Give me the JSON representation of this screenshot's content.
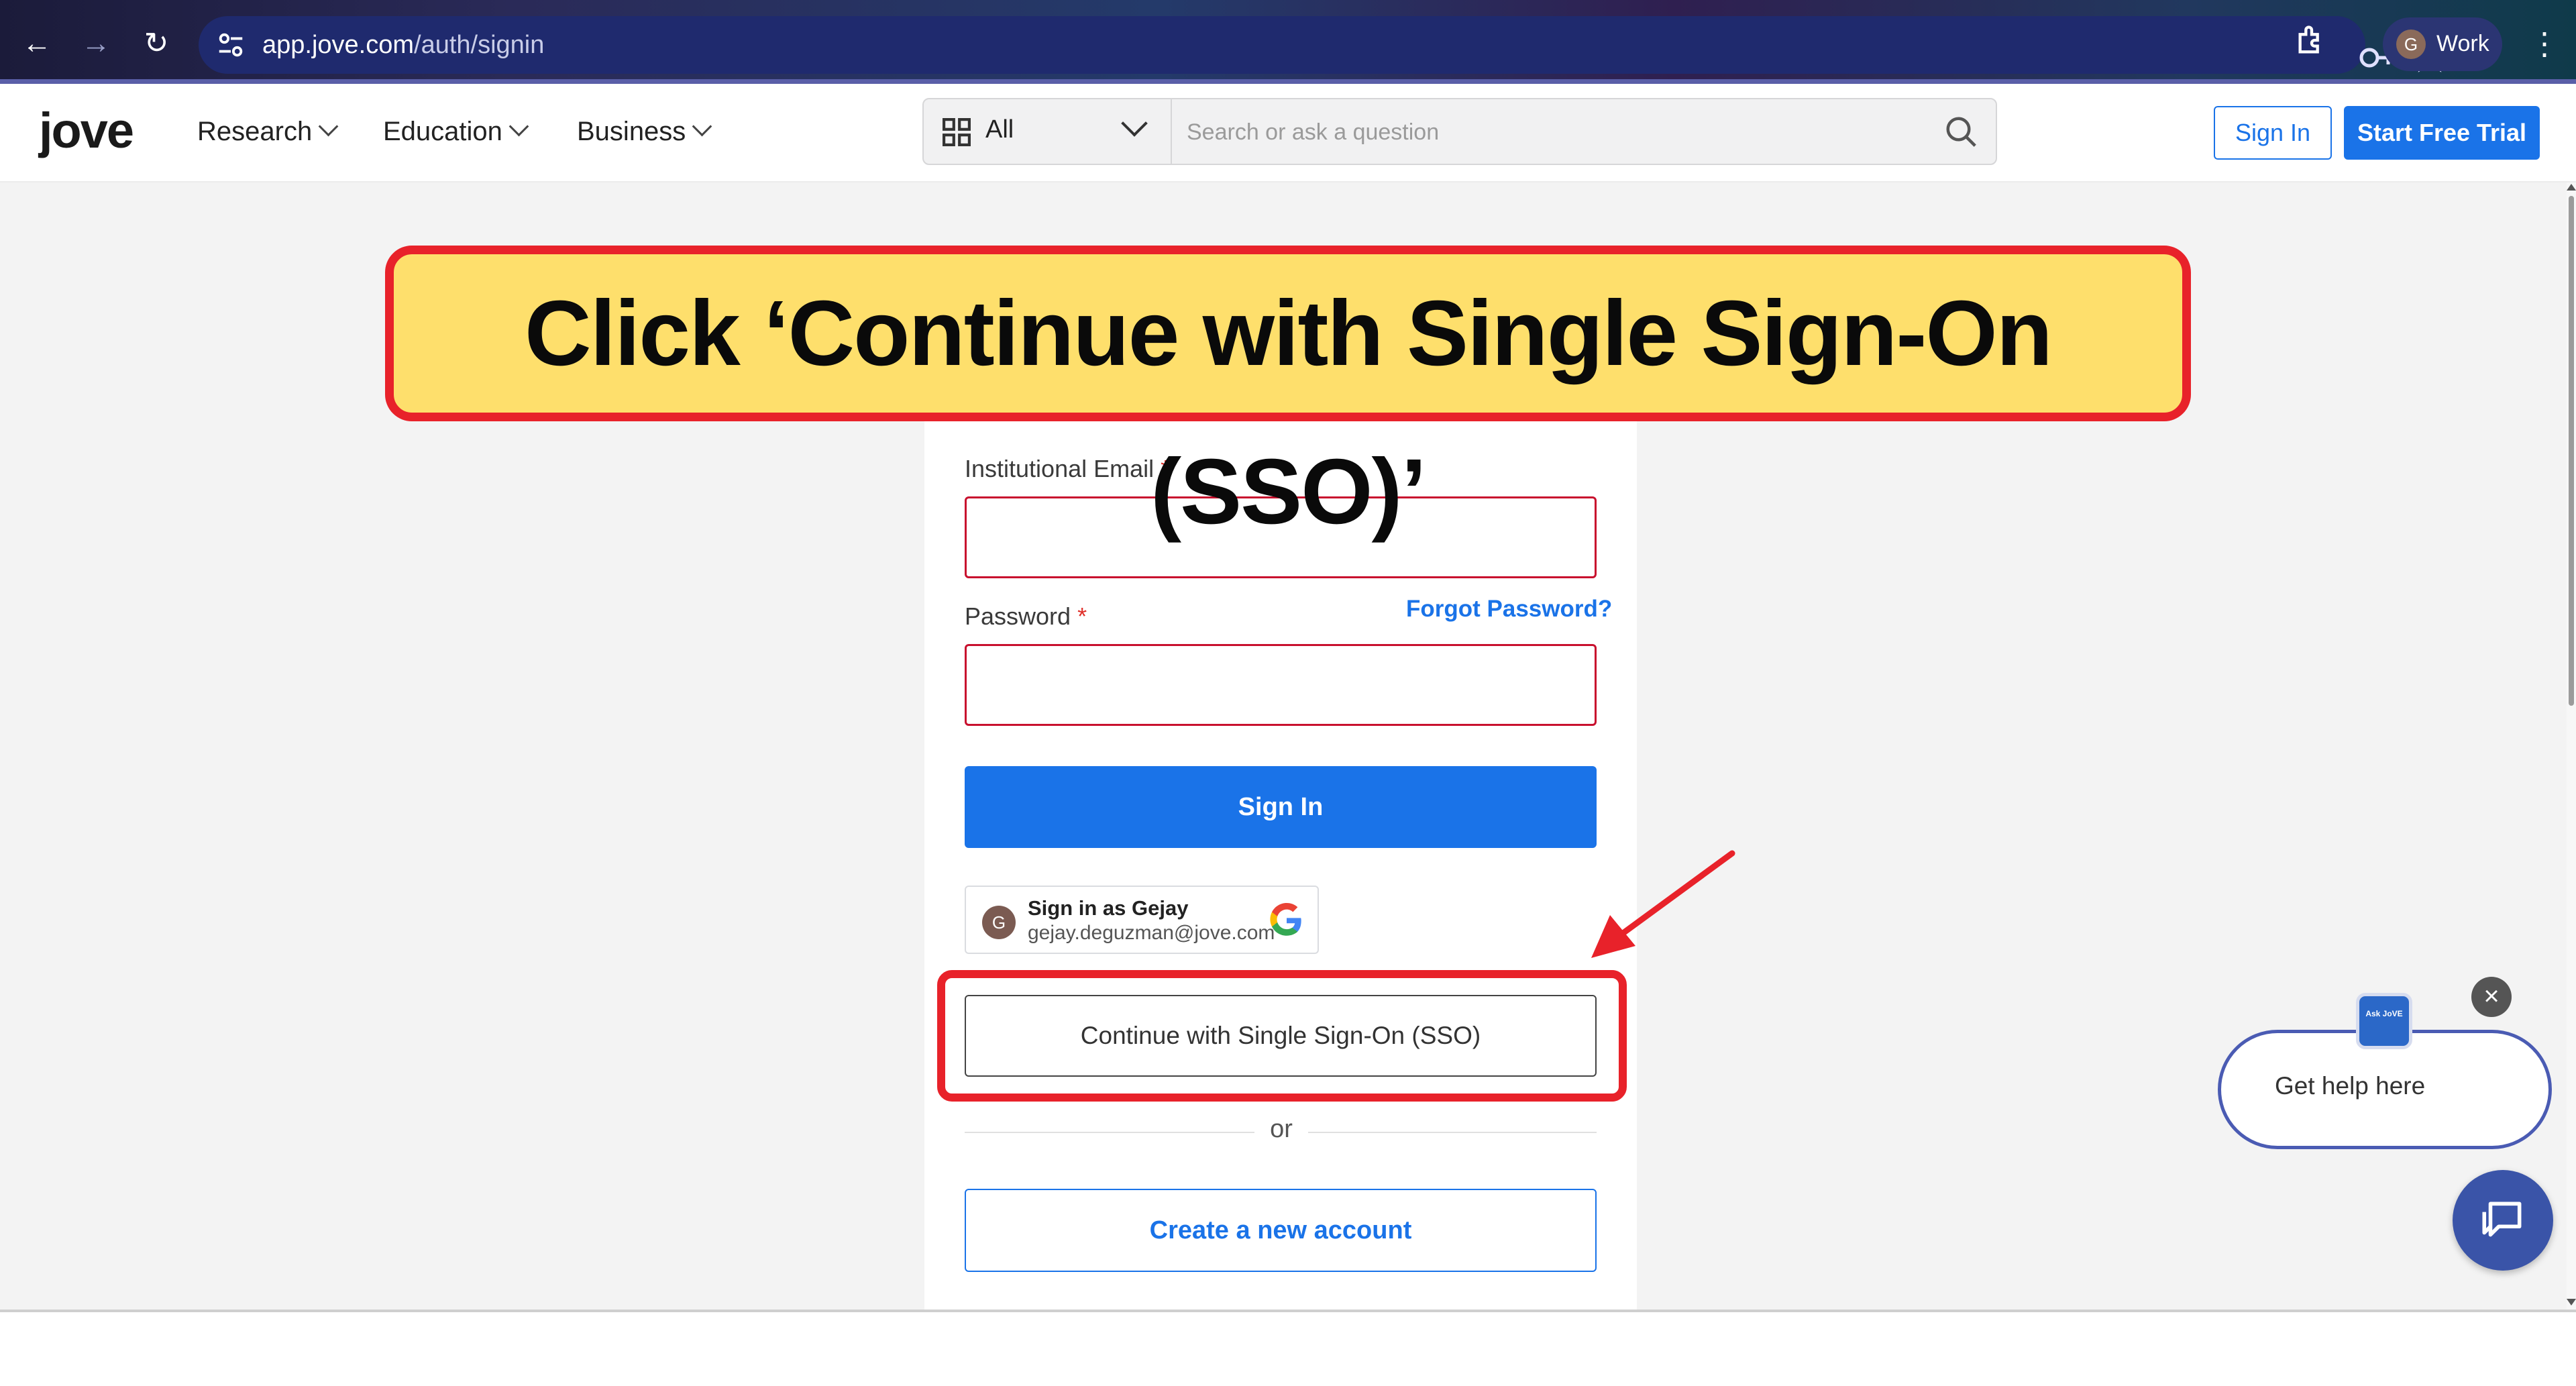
{
  "browser": {
    "url_host": "app.jove.com",
    "url_path": "/auth/signin",
    "profile_initial": "G",
    "profile_label": "Work"
  },
  "header": {
    "logo": "jove",
    "nav": [
      {
        "label": "Research"
      },
      {
        "label": "Education"
      },
      {
        "label": "Business"
      }
    ],
    "search": {
      "scope": "All",
      "placeholder": "Search or ask a question"
    },
    "signin_label": "Sign In",
    "trial_label": "Start Free Trial"
  },
  "banner": {
    "text": "Click ‘Continue with Single Sign-On (SSO)’"
  },
  "form": {
    "email_label": "Institutional Email",
    "password_label": "Password",
    "required_mark": "*",
    "forgot_label": "Forgot Password?",
    "signin_label": "Sign In",
    "google": {
      "avatar_initial": "G",
      "name": "Sign in as Gejay",
      "email": "gejay.deguzman@jove.com"
    },
    "sso_label": "Continue with Single Sign-On (SSO)",
    "or_label": "or",
    "create_label": "Create a new account"
  },
  "help": {
    "close_symbol": "×",
    "badge_text": "Ask JoVE",
    "text": "Get help here"
  },
  "colors": {
    "accent": "#1a73e8",
    "highlight": "#e8222a",
    "banner_bg": "#fedf6c"
  }
}
